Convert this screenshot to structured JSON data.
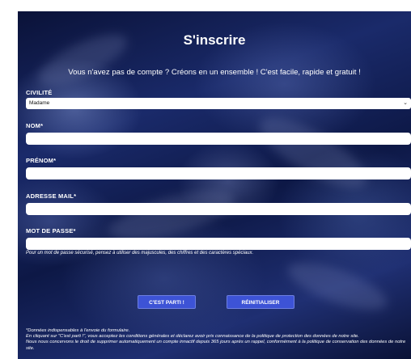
{
  "page": {
    "title": "S'inscrire",
    "subtitle": "Vous n'avez pas de compte ? Créons en un ensemble ! C'est facile, rapide et gratuit !"
  },
  "form": {
    "civilite": {
      "label": "CIVILITÉ",
      "selected": "Madame",
      "icon": "chevron-down-icon"
    },
    "nom": {
      "label": "NOM*",
      "value": ""
    },
    "prenom": {
      "label": "PRÉNOM*",
      "value": ""
    },
    "email": {
      "label": "ADRESSE MAIL*",
      "value": ""
    },
    "password": {
      "label": "MOT DE PASSE*",
      "value": "",
      "hint": "Pour un mot de passe sécurisé, pensez à utiliser des majuscules, des chiffres et des caractères spéciaux."
    }
  },
  "buttons": {
    "submit": "C'EST PARTI !",
    "reset": "RÉINITIALISER"
  },
  "footer": {
    "line1": "*Données indispensables à l'envoie du formulaire.",
    "line2": "En cliquant sur \"C'est parti !\", vous acceptez les conditions générales et déclarez avoir pris connaissance de la politique de protection des données de notre site.",
    "line3": "Nous nous concervons le droit de supprimer automatiquement un compte innactif depuis 365 jours après un rappel, conformément à la politique de conservation des données de notre site."
  },
  "colors": {
    "button": "#3d53d6",
    "background": "#1a2a6a",
    "text": "#ffffff"
  }
}
